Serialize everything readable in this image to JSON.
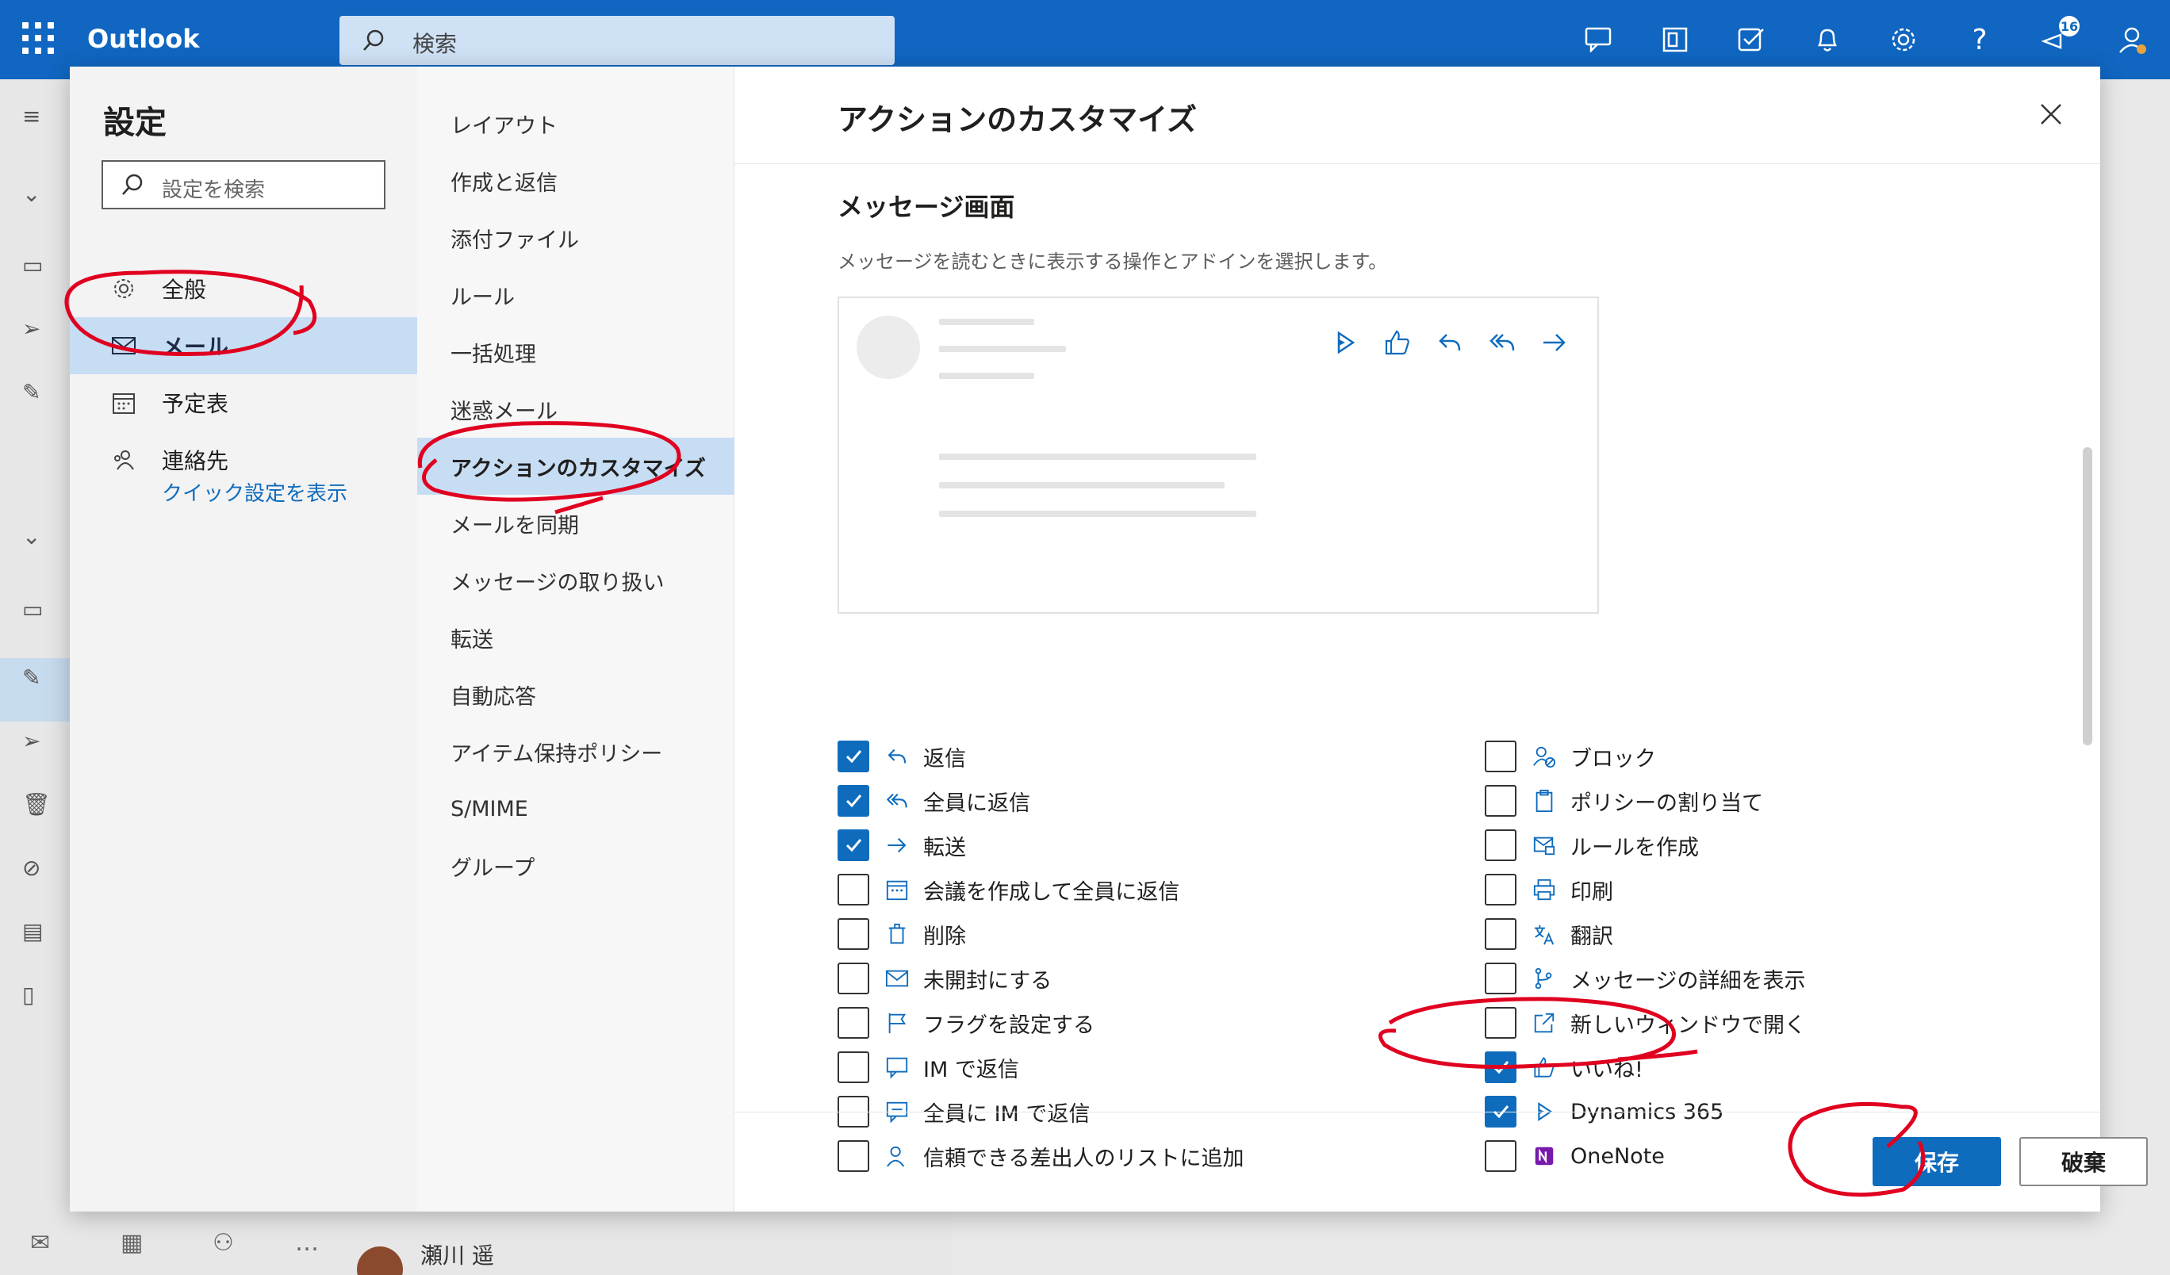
{
  "app": {
    "title": "Outlook",
    "search_placeholder": "検索",
    "notification_count": "16"
  },
  "settings": {
    "title": "設定",
    "search_placeholder": "設定を検索",
    "categories": [
      {
        "label": "全般",
        "icon": "gear-icon"
      },
      {
        "label": "メール",
        "icon": "mail-icon",
        "selected": true
      },
      {
        "label": "予定表",
        "icon": "calendar-icon"
      },
      {
        "label": "連絡先",
        "icon": "people-icon"
      }
    ],
    "quick_settings_link": "クイック設定を表示"
  },
  "mail_sections": [
    "レイアウト",
    "作成と返信",
    "添付ファイル",
    "ルール",
    "一括処理",
    "迷惑メール",
    "アクションのカスタマイズ",
    "メールを同期",
    "メッセージの取り扱い",
    "転送",
    "自動応答",
    "アイテム保持ポリシー",
    "S/MIME",
    "グループ"
  ],
  "selected_section": "アクションのカスタマイズ",
  "panel": {
    "title": "アクションのカスタマイズ",
    "section_title": "メッセージ画面",
    "section_desc": "メッセージを読むときに表示する操作とアドインを選択します。",
    "left_options": [
      {
        "label": "返信",
        "icon": "reply-icon",
        "checked": true
      },
      {
        "label": "全員に返信",
        "icon": "reply-all-icon",
        "checked": true
      },
      {
        "label": "転送",
        "icon": "forward-icon",
        "checked": true
      },
      {
        "label": "会議を作成して全員に返信",
        "icon": "calendar-reply-icon",
        "checked": false
      },
      {
        "label": "削除",
        "icon": "trash-icon",
        "checked": false
      },
      {
        "label": "未開封にする",
        "icon": "envelope-icon",
        "checked": false
      },
      {
        "label": "フラグを設定する",
        "icon": "flag-icon",
        "checked": false
      },
      {
        "label": "IM で返信",
        "icon": "chat-icon",
        "checked": false
      },
      {
        "label": "全員に IM で返信",
        "icon": "chat-all-icon",
        "checked": false
      },
      {
        "label": "信頼できる差出人のリストに追加",
        "icon": "person-add-icon",
        "checked": false
      }
    ],
    "right_options": [
      {
        "label": "ブロック",
        "icon": "block-person-icon",
        "checked": false
      },
      {
        "label": "ポリシーの割り当て",
        "icon": "clipboard-icon",
        "checked": false
      },
      {
        "label": "ルールを作成",
        "icon": "rule-icon",
        "checked": false
      },
      {
        "label": "印刷",
        "icon": "print-icon",
        "checked": false
      },
      {
        "label": "翻訳",
        "icon": "translate-icon",
        "checked": false
      },
      {
        "label": "メッセージの詳細を表示",
        "icon": "details-icon",
        "checked": false
      },
      {
        "label": "新しいウィンドウで開く",
        "icon": "open-window-icon",
        "checked": false
      },
      {
        "label": "いいね!",
        "icon": "like-icon",
        "checked": true
      },
      {
        "label": "Dynamics 365",
        "icon": "dynamics-icon",
        "checked": true
      },
      {
        "label": "OneNote",
        "icon": "onenote-icon",
        "checked": false
      }
    ],
    "save_label": "保存",
    "discard_label": "破棄"
  },
  "background": {
    "contact_name": "瀬川 遥"
  },
  "colors": {
    "accent": "#0f6cbd",
    "annotation": "#e00020",
    "selected_bg": "#c7ddf3"
  }
}
